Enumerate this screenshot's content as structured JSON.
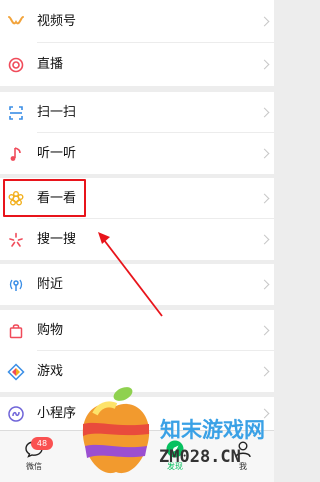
{
  "discover": {
    "groups": [
      {
        "items": [
          {
            "label": "视频号",
            "icon": "channels-icon"
          },
          {
            "label": "直播",
            "icon": "live-icon"
          }
        ]
      },
      {
        "items": [
          {
            "label": "扫一扫",
            "icon": "scan-icon"
          },
          {
            "label": "听一听",
            "icon": "music-note-icon"
          }
        ]
      },
      {
        "items": [
          {
            "label": "看一看",
            "icon": "top-stories-icon"
          },
          {
            "label": "搜一搜",
            "icon": "search-sparkle-icon"
          }
        ]
      },
      {
        "items": [
          {
            "label": "附近",
            "icon": "nearby-icon"
          }
        ]
      },
      {
        "items": [
          {
            "label": "购物",
            "icon": "shopping-bag-icon"
          },
          {
            "label": "游戏",
            "icon": "game-icon"
          }
        ]
      },
      {
        "items": [
          {
            "label": "小程序",
            "icon": "mini-program-icon"
          }
        ]
      }
    ]
  },
  "tabbar": {
    "items": [
      {
        "label": "微信",
        "badge": "48"
      },
      {
        "label": "发现"
      },
      {
        "label": "我"
      }
    ]
  },
  "colors": {
    "highlight": "#e8141b",
    "accent_green": "#07c160",
    "badge": "#fa5151"
  },
  "watermark": {
    "title": "知末游戏网",
    "domain": "ZM028.CN"
  }
}
